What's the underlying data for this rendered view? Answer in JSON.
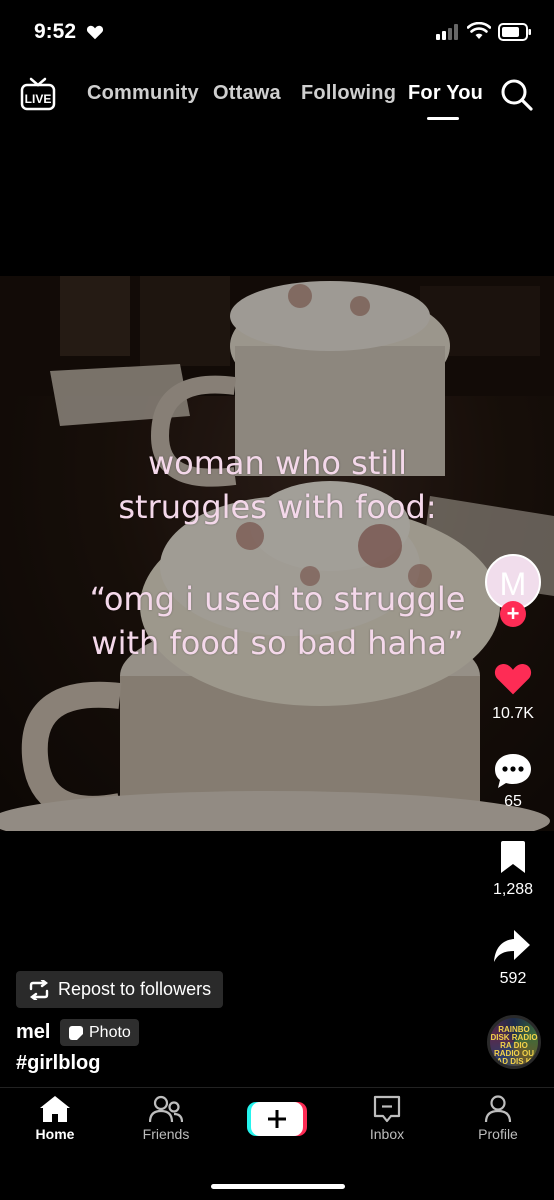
{
  "status_bar": {
    "time": "9:52"
  },
  "top_nav": {
    "tabs": [
      "Community",
      "Ottawa",
      "Following",
      "For You"
    ],
    "active_tab": "For You"
  },
  "post": {
    "overlay_lines_1": "woman who still\nstruggles with food:",
    "overlay_lines_2": "“omg i used to struggle\nwith food so bad haha”",
    "author_initial": "M",
    "username": "mel",
    "type_badge": "Photo",
    "caption": "#girlblog",
    "repost_label": "Repost to followers",
    "music_disc_text": "RAINBO DISK RADIO RA DIO RADIO OU AD DIS K AD"
  },
  "actions": {
    "likes": "10.7K",
    "comments": "65",
    "bookmarks": "1,288",
    "shares": "592"
  },
  "bottom_nav": {
    "home": "Home",
    "friends": "Friends",
    "inbox": "Inbox",
    "profile": "Profile"
  },
  "colors": {
    "accent_red": "#fe2c55",
    "like_red": "#fe2c55",
    "overlay_text": "#f4d8ea",
    "icons": [
      "live-icon",
      "search-icon",
      "heart-icon",
      "comment-icon",
      "bookmark-icon",
      "share-icon",
      "home-icon",
      "friends-icon",
      "inbox-icon",
      "profile-icon",
      "repost-icon",
      "photo-icon"
    ]
  }
}
